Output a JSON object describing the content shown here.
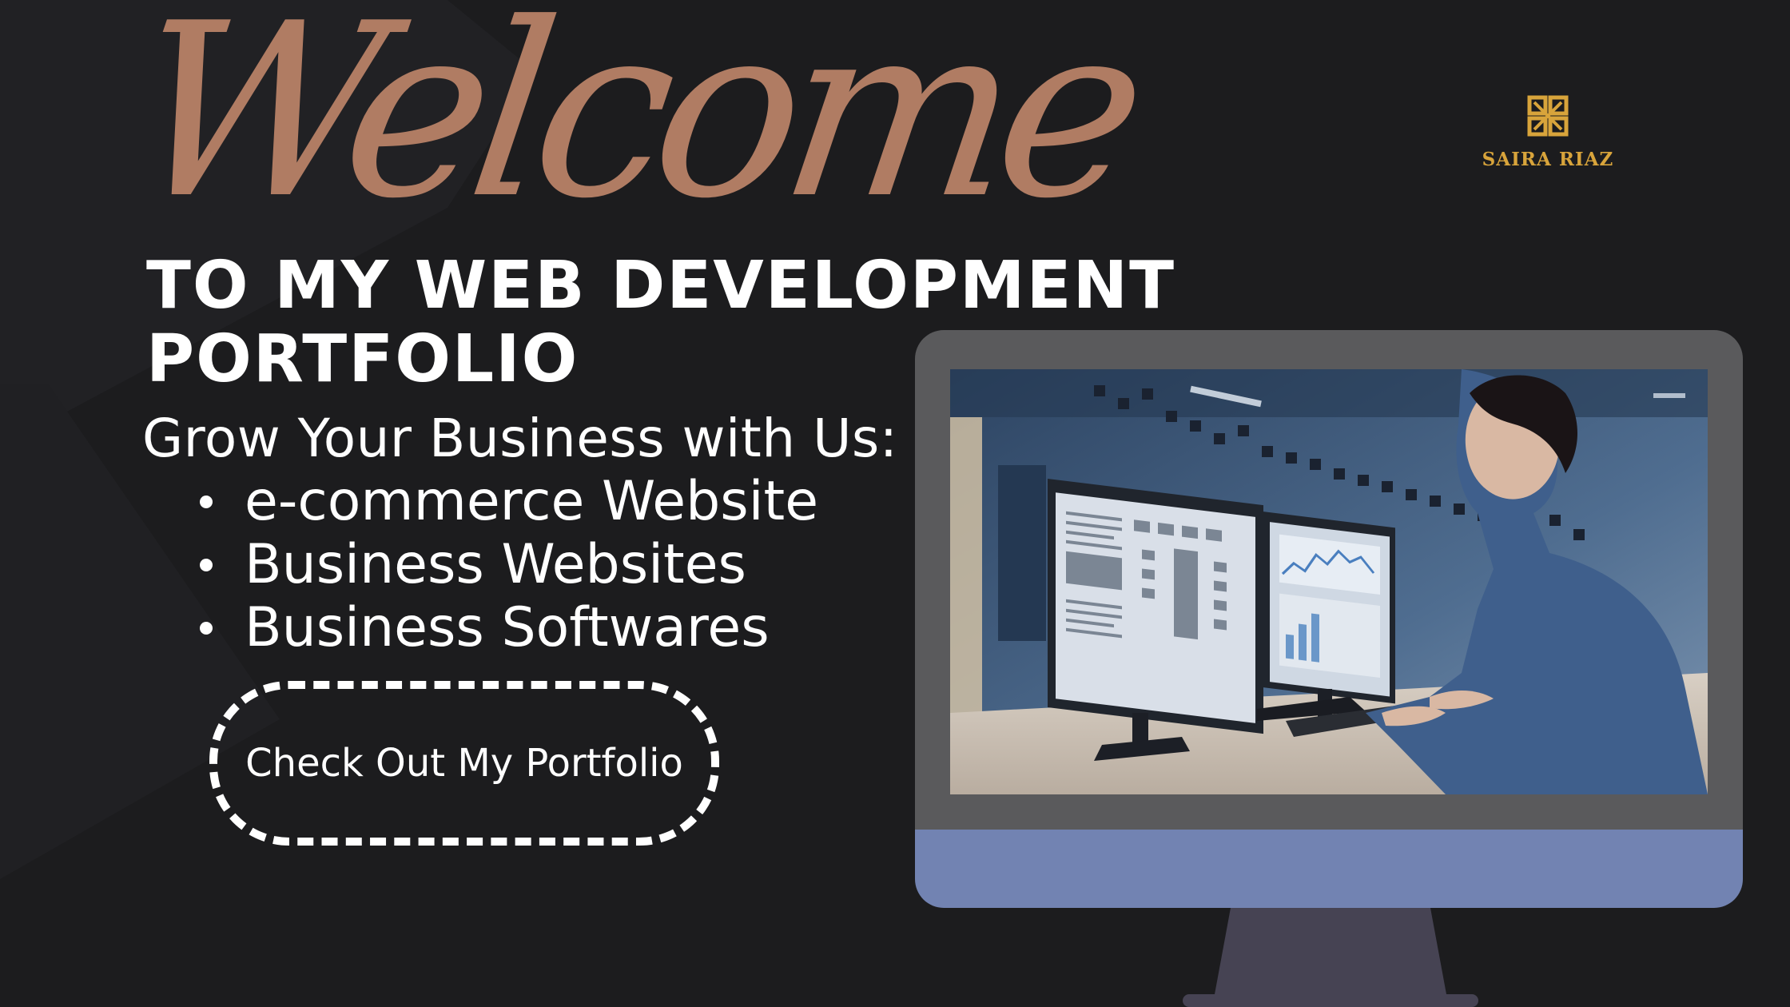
{
  "hero": {
    "welcome": "Welcome",
    "heading_line1": "TO MY WEB DEVELOPMENT",
    "heading_line2": "PORTFOLIO",
    "tagline": "Grow Your Business with Us:",
    "services": [
      "e-commerce Website",
      "Business Websites",
      "Business Softwares"
    ],
    "cta_label": "Check Out My Portfolio"
  },
  "brand": {
    "name": "SAIRA RIAZ",
    "logo_icon": "monogram-icon"
  },
  "illustration": {
    "monitor_icon": "desktop-monitor",
    "photo": "woman-at-computer-workstation"
  },
  "colors": {
    "background": "#1c1c1e",
    "welcome_script": "#b07c63",
    "brand_gold": "#d8a43b",
    "monitor_bezel": "#5a5a5c",
    "monitor_chin": "#7283b2",
    "monitor_stand": "#464353"
  }
}
